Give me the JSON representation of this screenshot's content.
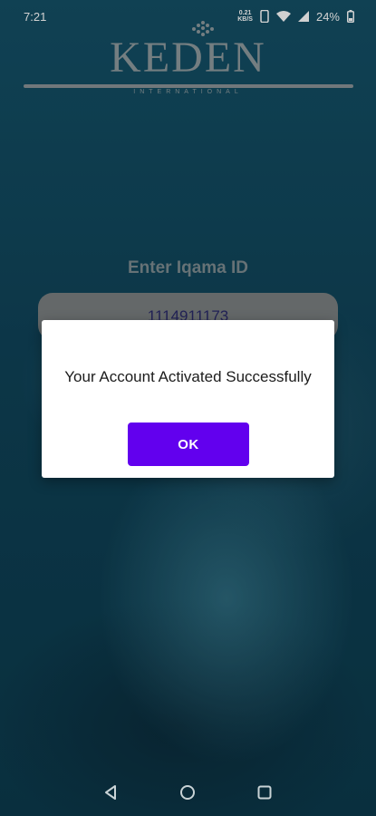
{
  "status_bar": {
    "time": "7:21",
    "net_speed_value": "0.21",
    "net_speed_unit": "KB/S",
    "battery_percent": "24%",
    "icons": [
      "phone-icon",
      "wifi-icon",
      "signal-icon",
      "battery-icon"
    ]
  },
  "logo": {
    "title": "KEDEN",
    "subtitle": "INTERNATIONAL"
  },
  "form": {
    "label": "Enter Iqama ID",
    "iqama_value": "1114911173"
  },
  "dialog": {
    "message": "Your Account Activated Successfully",
    "ok_label": "OK",
    "button_color": "#6200ee"
  },
  "nav_bar": {
    "icons": [
      "back-icon",
      "home-icon",
      "recents-icon"
    ]
  }
}
